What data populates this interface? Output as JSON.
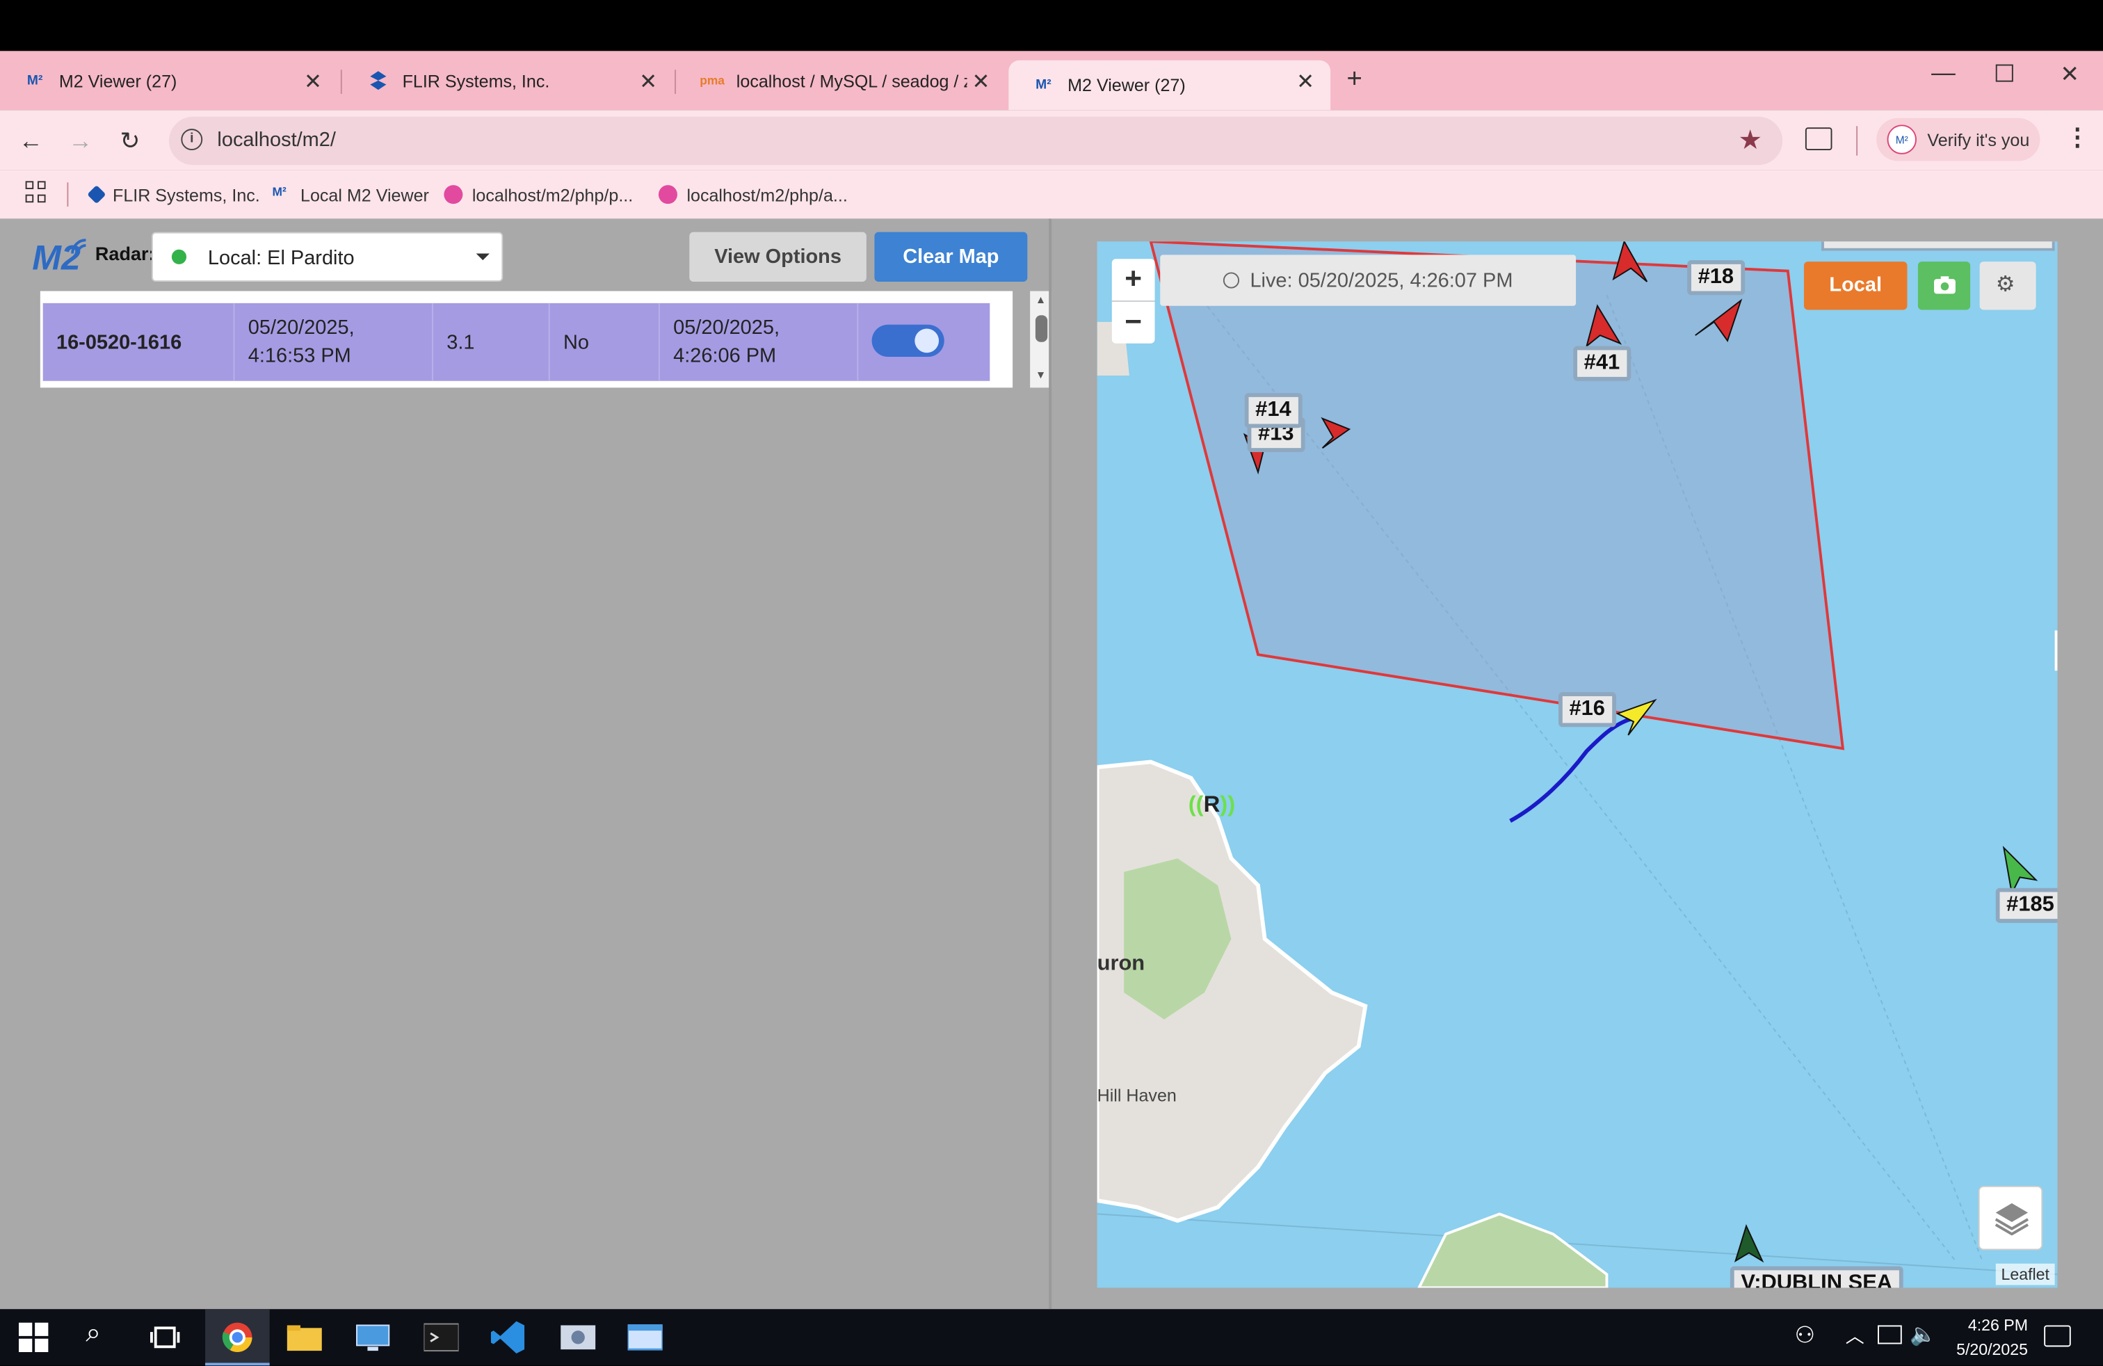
{
  "browser": {
    "tabs": [
      {
        "title": "M2 Viewer (27)",
        "active": false
      },
      {
        "title": "FLIR Systems, Inc.",
        "active": false
      },
      {
        "title": "localhost / MySQL / seadog / z",
        "active": false
      },
      {
        "title": "M2 Viewer (27)",
        "active": true
      }
    ],
    "url": "localhost/m2/",
    "profile_label": "Verify it's you",
    "bookmarks": [
      "FLIR Systems, Inc.",
      "Local M2 Viewer",
      "localhost/m2/php/p...",
      "localhost/m2/php/a..."
    ]
  },
  "panel": {
    "logo": "M2",
    "radar_label": "Radar:",
    "radar_value": "Local: El Pardito",
    "view_options_label": "View Options",
    "clear_map_label": "Clear Map",
    "row": {
      "id": "16-0520-1616",
      "start_line1": "05/20/2025,",
      "start_line2": "4:16:53 PM",
      "value": "3.1",
      "flag": "No",
      "end_line1": "05/20/2025,",
      "end_line2": "4:26:06 PM",
      "toggle_on": true
    }
  },
  "map": {
    "zoom_in": "+",
    "zoom_out": "−",
    "live_status": "Live: 05/20/2025, 4:26:07 PM",
    "local_label": "Local",
    "targets": [
      "#18",
      "#41",
      "#14",
      "#13",
      "#16",
      "#185",
      "V:DUBLIN SEA"
    ],
    "radar_marker": "R",
    "place_labels": [
      "uron",
      "Hill Haven"
    ],
    "attribution": "Leaflet"
  },
  "taskbar": {
    "time": "4:26 PM",
    "date": "5/20/2025"
  },
  "colors": {
    "tab_bar": "#f6b9c8",
    "row_highlight": "#a59be3",
    "clear_map": "#3d82d3",
    "local_button": "#ea7a2b",
    "water": "#8ccfee",
    "zone_border": "#e0383a"
  }
}
